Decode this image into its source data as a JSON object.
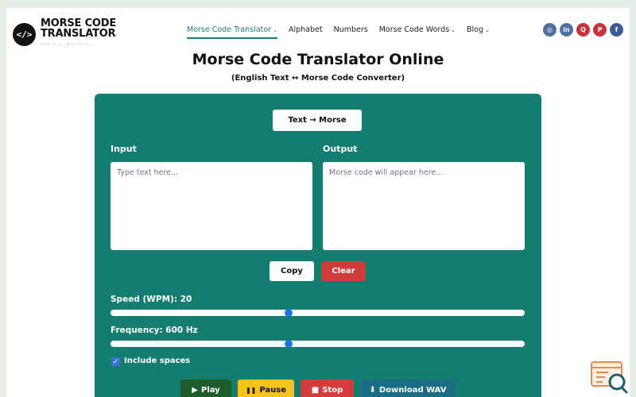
{
  "logo": {
    "badge": "</>",
    "line1": "MORSE CODE",
    "line2": "TRANSLATOR",
    "sub": "-- --- .-. ... . / -.-. --- -.. ."
  },
  "nav": [
    {
      "label": "Morse Code Translator",
      "caret": true,
      "active": true
    },
    {
      "label": "Alphabet",
      "caret": false,
      "active": false
    },
    {
      "label": "Numbers",
      "caret": false,
      "active": false
    },
    {
      "label": "Morse Code Words",
      "caret": true,
      "active": false
    },
    {
      "label": "Blog",
      "caret": true,
      "active": false
    }
  ],
  "socials": [
    {
      "name": "instagram-icon",
      "glyph": "◎",
      "color": "#4f6fa3"
    },
    {
      "name": "linkedin-icon",
      "glyph": "in",
      "color": "#4f6fa3"
    },
    {
      "name": "quora-icon",
      "glyph": "Q",
      "color": "#c8323a"
    },
    {
      "name": "pinterest-icon",
      "glyph": "P",
      "color": "#c8323a"
    },
    {
      "name": "facebook-icon",
      "glyph": "f",
      "color": "#3d5a98"
    }
  ],
  "page": {
    "title": "Morse Code Translator Online",
    "subtitle": "(English Text ↔ Morse Code Converter)"
  },
  "translator": {
    "mode_button": "Text → Morse",
    "input_label": "Input",
    "input_placeholder": "Type text here...",
    "output_label": "Output",
    "output_placeholder": "Morse code will appear here...",
    "copy_label": "Copy",
    "clear_label": "Clear",
    "speed_label": "Speed (WPM): 20",
    "speed_fraction": 0.43,
    "frequency_label": "Frequency: 600 Hz",
    "frequency_fraction": 0.43,
    "include_spaces_label": "Include spaces",
    "include_spaces_checked": true,
    "play_label": "Play",
    "pause_label": "Pause",
    "stop_label": "Stop",
    "download_label": "Download WAV"
  },
  "colors": {
    "accent": "#137d6f",
    "nav_active": "#1b7e6e",
    "clear": "#cf3b3b"
  }
}
